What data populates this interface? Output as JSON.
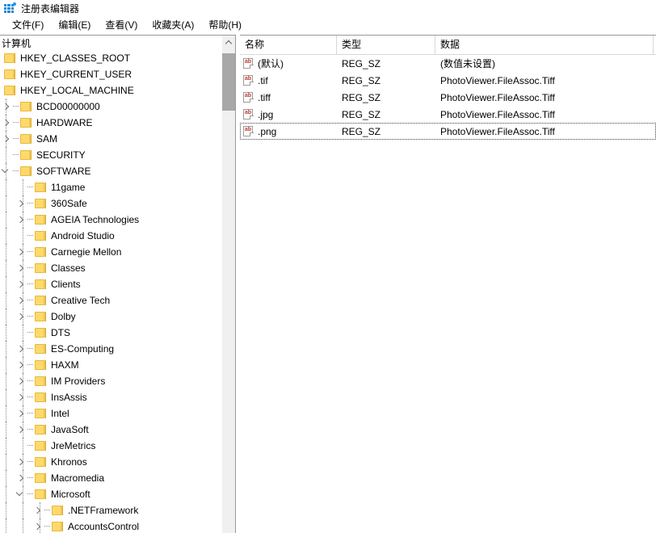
{
  "window": {
    "title": "注册表编辑器",
    "icon": "registry-editor-icon"
  },
  "menubar": {
    "items": [
      {
        "label": "文件(F)",
        "name": "menu-file"
      },
      {
        "label": "编辑(E)",
        "name": "menu-edit"
      },
      {
        "label": "查看(V)",
        "name": "menu-view"
      },
      {
        "label": "收藏夹(A)",
        "name": "menu-favorites"
      },
      {
        "label": "帮助(H)",
        "name": "menu-help"
      }
    ]
  },
  "tree": {
    "root_label": "计算机",
    "nodes": [
      {
        "label": "HKEY_CLASSES_ROOT",
        "depth": 0,
        "state": "none"
      },
      {
        "label": "HKEY_CURRENT_USER",
        "depth": 0,
        "state": "none"
      },
      {
        "label": "HKEY_LOCAL_MACHINE",
        "depth": 0,
        "state": "none"
      },
      {
        "label": "BCD00000000",
        "depth": 1,
        "state": "collapsed"
      },
      {
        "label": "HARDWARE",
        "depth": 1,
        "state": "collapsed"
      },
      {
        "label": "SAM",
        "depth": 1,
        "state": "collapsed"
      },
      {
        "label": "SECURITY",
        "depth": 1,
        "state": "none"
      },
      {
        "label": "SOFTWARE",
        "depth": 1,
        "state": "expanded"
      },
      {
        "label": "11game",
        "depth": 2,
        "state": "none"
      },
      {
        "label": "360Safe",
        "depth": 2,
        "state": "collapsed"
      },
      {
        "label": "AGEIA Technologies",
        "depth": 2,
        "state": "collapsed"
      },
      {
        "label": "Android Studio",
        "depth": 2,
        "state": "none"
      },
      {
        "label": "Carnegie Mellon",
        "depth": 2,
        "state": "collapsed"
      },
      {
        "label": "Classes",
        "depth": 2,
        "state": "collapsed"
      },
      {
        "label": "Clients",
        "depth": 2,
        "state": "collapsed"
      },
      {
        "label": "Creative Tech",
        "depth": 2,
        "state": "collapsed"
      },
      {
        "label": "Dolby",
        "depth": 2,
        "state": "collapsed"
      },
      {
        "label": "DTS",
        "depth": 2,
        "state": "none"
      },
      {
        "label": "ES-Computing",
        "depth": 2,
        "state": "collapsed"
      },
      {
        "label": "HAXM",
        "depth": 2,
        "state": "collapsed"
      },
      {
        "label": "IM Providers",
        "depth": 2,
        "state": "collapsed"
      },
      {
        "label": "InsAssis",
        "depth": 2,
        "state": "collapsed"
      },
      {
        "label": "Intel",
        "depth": 2,
        "state": "collapsed"
      },
      {
        "label": "JavaSoft",
        "depth": 2,
        "state": "collapsed"
      },
      {
        "label": "JreMetrics",
        "depth": 2,
        "state": "none"
      },
      {
        "label": "Khronos",
        "depth": 2,
        "state": "collapsed"
      },
      {
        "label": "Macromedia",
        "depth": 2,
        "state": "collapsed"
      },
      {
        "label": "Microsoft",
        "depth": 2,
        "state": "expanded"
      },
      {
        "label": ".NETFramework",
        "depth": 3,
        "state": "collapsed"
      },
      {
        "label": "AccountsControl",
        "depth": 3,
        "state": "collapsed"
      }
    ]
  },
  "list": {
    "columns": [
      {
        "label": "名称",
        "name": "column-name"
      },
      {
        "label": "类型",
        "name": "column-type"
      },
      {
        "label": "数据",
        "name": "column-data"
      }
    ],
    "rows": [
      {
        "name": "(默认)",
        "type": "REG_SZ",
        "data": "(数值未设置)",
        "focused": false
      },
      {
        "name": ".tif",
        "type": "REG_SZ",
        "data": "PhotoViewer.FileAssoc.Tiff",
        "focused": false
      },
      {
        "name": ".tiff",
        "type": "REG_SZ",
        "data": "PhotoViewer.FileAssoc.Tiff",
        "focused": false
      },
      {
        "name": ".jpg",
        "type": "REG_SZ",
        "data": "PhotoViewer.FileAssoc.Tiff",
        "focused": false
      },
      {
        "name": ".png",
        "type": "REG_SZ",
        "data": "PhotoViewer.FileAssoc.Tiff",
        "focused": true
      }
    ],
    "value_icon_text": "ab"
  },
  "scrollbar": {
    "up_arrow": "scroll-up-arrow"
  },
  "colors": {
    "folder": "#ffd96b",
    "ab_red": "#c0392b",
    "icon_blue": "#1e8bd6",
    "thumb": "#a8a8a8"
  }
}
